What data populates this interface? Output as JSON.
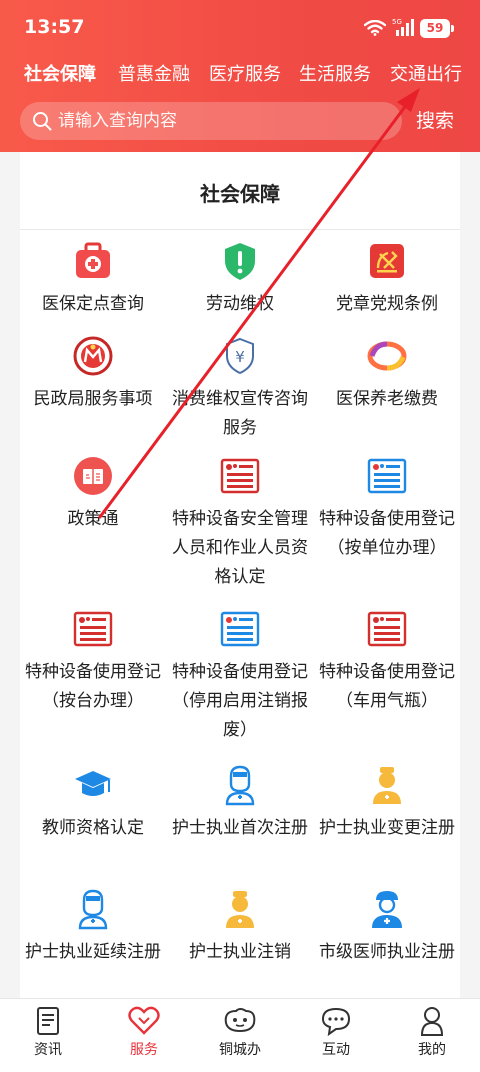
{
  "status": {
    "time": "13:57",
    "battery": "59"
  },
  "tabs": [
    {
      "label": "社会保障"
    },
    {
      "label": "普惠金融"
    },
    {
      "label": "医疗服务"
    },
    {
      "label": "生活服务"
    },
    {
      "label": "交通出行"
    }
  ],
  "search": {
    "placeholder": "请输入查询内容",
    "button": "搜索"
  },
  "section": {
    "title": "社会保障"
  },
  "items": [
    {
      "label": "医保定点查询",
      "icon": "medical-kit-icon"
    },
    {
      "label": "劳动维权",
      "icon": "shield-alert-icon"
    },
    {
      "label": "党章党规条例",
      "icon": "party-emblem-icon"
    },
    {
      "label": "民政局服务事项",
      "icon": "civil-affairs-logo-icon"
    },
    {
      "label": "消费维权宣传咨询服务",
      "icon": "yuan-shield-icon"
    },
    {
      "label": "医保养老缴费",
      "icon": "colorful-ring-icon"
    },
    {
      "label": "政策通",
      "icon": "policy-book-icon"
    },
    {
      "label": "特种设备安全管理人员和作业人员资格认定",
      "icon": "certificate-red-icon"
    },
    {
      "label": "特种设备使用登记（按单位办理）",
      "icon": "certificate-blue-icon"
    },
    {
      "label": "特种设备使用登记（按台办理）",
      "icon": "certificate-red-icon"
    },
    {
      "label": "特种设备使用登记（停用启用注销报废）",
      "icon": "certificate-blue-icon"
    },
    {
      "label": "特种设备使用登记（车用气瓶）",
      "icon": "certificate-red-icon"
    },
    {
      "label": "教师资格认定",
      "icon": "graduation-cap-icon"
    },
    {
      "label": "护士执业首次注册",
      "icon": "nurse-blue-icon"
    },
    {
      "label": "护士执业变更注册",
      "icon": "nurse-gold-icon"
    },
    {
      "label": "护士执业延续注册",
      "icon": "nurse-blue-icon"
    },
    {
      "label": "护士执业注销",
      "icon": "nurse-gold-icon"
    },
    {
      "label": "市级医师执业注册",
      "icon": "doctor-blue-icon"
    }
  ],
  "bottom_nav": [
    {
      "label": "资讯",
      "icon": "news-icon"
    },
    {
      "label": "服务",
      "icon": "heart-icon"
    },
    {
      "label": "铜城办",
      "icon": "city-mascot-icon"
    },
    {
      "label": "互动",
      "icon": "chat-icon"
    },
    {
      "label": "我的",
      "icon": "person-icon"
    }
  ],
  "colors": {
    "header": "#f14b45",
    "active_tab": "#e8323a",
    "arrow": "#e8202a"
  }
}
